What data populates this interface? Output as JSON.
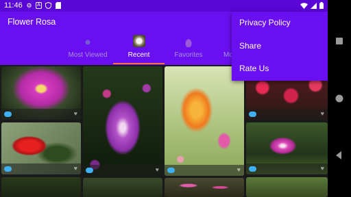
{
  "status_bar": {
    "time": "11:46",
    "icons": [
      "gear-icon",
      "a-icon",
      "shield-icon",
      "sd-card-icon"
    ],
    "right_icons": [
      "wifi-icon",
      "signal-icon",
      "battery-icon"
    ]
  },
  "app": {
    "title": "Flower Rosa"
  },
  "tabs": [
    {
      "label": "Most Viewed",
      "icon": "most-viewed-icon",
      "active": false
    },
    {
      "label": "Recent",
      "icon": "recent-thumbnail",
      "active": true
    },
    {
      "label": "Favorites",
      "icon": "favorites-icon",
      "active": false
    },
    {
      "label": "Mo",
      "icon": "more-tab-icon",
      "active": false
    }
  ],
  "menu": {
    "items": [
      "Privacy Policy",
      "Share",
      "Rate Us"
    ]
  },
  "cards": [
    {
      "flower": "pink wild rose",
      "colors": [
        "#2a3a26",
        "#c533b5",
        "#f7d25a"
      ]
    },
    {
      "flower": "red hibiscus",
      "colors": [
        "#7a8f6a",
        "#d81b1b",
        "#203318"
      ]
    },
    {
      "flower": "purple zinnia",
      "colors": [
        "#1c2b16",
        "#9a3fb3",
        "#e07bd0"
      ]
    },
    {
      "flower": "orange lily",
      "colors": [
        "#c8d7a6",
        "#f07a1e",
        "#e04aa1"
      ]
    },
    {
      "flower": "pink roses",
      "colors": [
        "#5a1a22",
        "#e02a54",
        "#2a3a2a"
      ]
    },
    {
      "flower": "pink wild rose bush",
      "colors": [
        "#395a2a",
        "#d02fa7",
        "#8fb07a"
      ]
    },
    {
      "flower": "pink flowers",
      "colors": [
        "#3a3a2a",
        "#e25ea8",
        "#56703f"
      ]
    },
    {
      "flower": "green foliage",
      "colors": [
        "#26361a",
        "#4a6a2a",
        "#1a2412"
      ]
    },
    {
      "flower": "green foliage",
      "colors": [
        "#40522a",
        "#7a9a4a",
        "#2a3a1a"
      ]
    }
  ],
  "nav_bar": {
    "buttons": [
      "overview-button",
      "home-button",
      "back-button"
    ]
  }
}
